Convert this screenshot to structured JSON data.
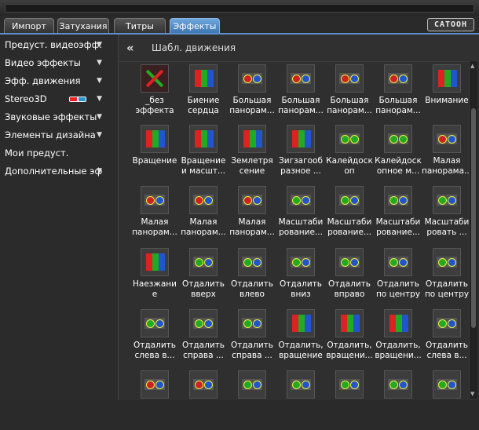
{
  "tabs": [
    {
      "label": "Импорт"
    },
    {
      "label": "Затухания"
    },
    {
      "label": "Титры"
    },
    {
      "label": "Эффекты"
    }
  ],
  "logo_text": "CATOOH",
  "sidebar": {
    "items": [
      {
        "label": "Предуст. видеоэфф."
      },
      {
        "label": "Видео эффекты"
      },
      {
        "label": "Эфф. движения"
      },
      {
        "label": "Stereo3D"
      },
      {
        "label": "Звуковые эффекты"
      },
      {
        "label": "Элементы дизайна"
      },
      {
        "label": "Мои предуст."
      },
      {
        "label": "Дополнительные эф"
      }
    ]
  },
  "breadcrumb": "Шабл. движения",
  "effects": [
    {
      "label": "_без\nэффекта",
      "icon": "no-effect-icon"
    },
    {
      "label": "Биение\nсердца",
      "icon": "heartbeat-icon"
    },
    {
      "label": "Большая\nпанорам...",
      "icon": "pan-icon"
    },
    {
      "label": "Большая\nпанорам...",
      "icon": "pan-icon"
    },
    {
      "label": "Большая\nпанорам...",
      "icon": "pan-icon"
    },
    {
      "label": "Большая\nпанорам...",
      "icon": "pan-icon"
    },
    {
      "label": "Внимание",
      "icon": "attention-icon"
    },
    {
      "label": "Вращение",
      "icon": "rotation-icon"
    },
    {
      "label": "Вращение\nи масшт...",
      "icon": "rotation-scale-icon"
    },
    {
      "label": "Землетря\nсение",
      "icon": "earthquake-icon"
    },
    {
      "label": "Зигзагооб\nразное ...",
      "icon": "zigzag-icon"
    },
    {
      "label": "Калейдоск\nоп",
      "icon": "kaleidoscope-icon"
    },
    {
      "label": "Калейдоск\nопное м...",
      "icon": "kaleidoscope-icon"
    },
    {
      "label": "Малая\nпанорама...",
      "icon": "pan-icon"
    },
    {
      "label": "Малая\nпанорам...",
      "icon": "pan-icon"
    },
    {
      "label": "Малая\nпанорам...",
      "icon": "pan-icon"
    },
    {
      "label": "Малая\nпанорам...",
      "icon": "pan-icon"
    },
    {
      "label": "Масштаби\nрование...",
      "icon": "scale-icon"
    },
    {
      "label": "Масштаби\nрование...",
      "icon": "scale-icon"
    },
    {
      "label": "Масштаби\nрование...",
      "icon": "scale-icon"
    },
    {
      "label": "Масштаби\nровать ...",
      "icon": "scale-icon"
    },
    {
      "label": "Наезжани\nе",
      "icon": "zoom-in-icon"
    },
    {
      "label": "Отдалить\nвверх",
      "icon": "zoom-out-icon"
    },
    {
      "label": "Отдалить\nвлево",
      "icon": "zoom-out-icon"
    },
    {
      "label": "Отдалить\nвниз",
      "icon": "zoom-out-icon"
    },
    {
      "label": "Отдалить\nвправо",
      "icon": "zoom-out-icon"
    },
    {
      "label": "Отдалить\nпо центру",
      "icon": "zoom-out-icon"
    },
    {
      "label": "Отдалить\nпо центру",
      "icon": "zoom-out-icon"
    },
    {
      "label": "Отдалить\nслева в...",
      "icon": "zoom-out-icon"
    },
    {
      "label": "Отдалить\nсправа ...",
      "icon": "zoom-out-icon"
    },
    {
      "label": "Отдалить\nсправа ...",
      "icon": "zoom-out-icon"
    },
    {
      "label": "Отдалить,\nвращение",
      "icon": "zoom-out-rotate-icon"
    },
    {
      "label": "Отдалить,\nвращени...",
      "icon": "zoom-out-rotate-icon"
    },
    {
      "label": "Отдалить,\nвращени...",
      "icon": "zoom-out-rotate-icon"
    },
    {
      "label": "Отдалить\nслева в...",
      "icon": "zoom-out-icon"
    },
    {
      "label": "",
      "icon": "pan-icon"
    },
    {
      "label": "",
      "icon": "pan-icon"
    },
    {
      "label": "",
      "icon": "scale-icon"
    },
    {
      "label": "",
      "icon": "scale-icon"
    },
    {
      "label": "",
      "icon": "scale-icon"
    },
    {
      "label": "",
      "icon": "scale-icon"
    },
    {
      "label": "",
      "icon": "scale-icon"
    }
  ],
  "colors": {
    "accent": "#4f86c6",
    "tab_active": "#5b93d1"
  }
}
